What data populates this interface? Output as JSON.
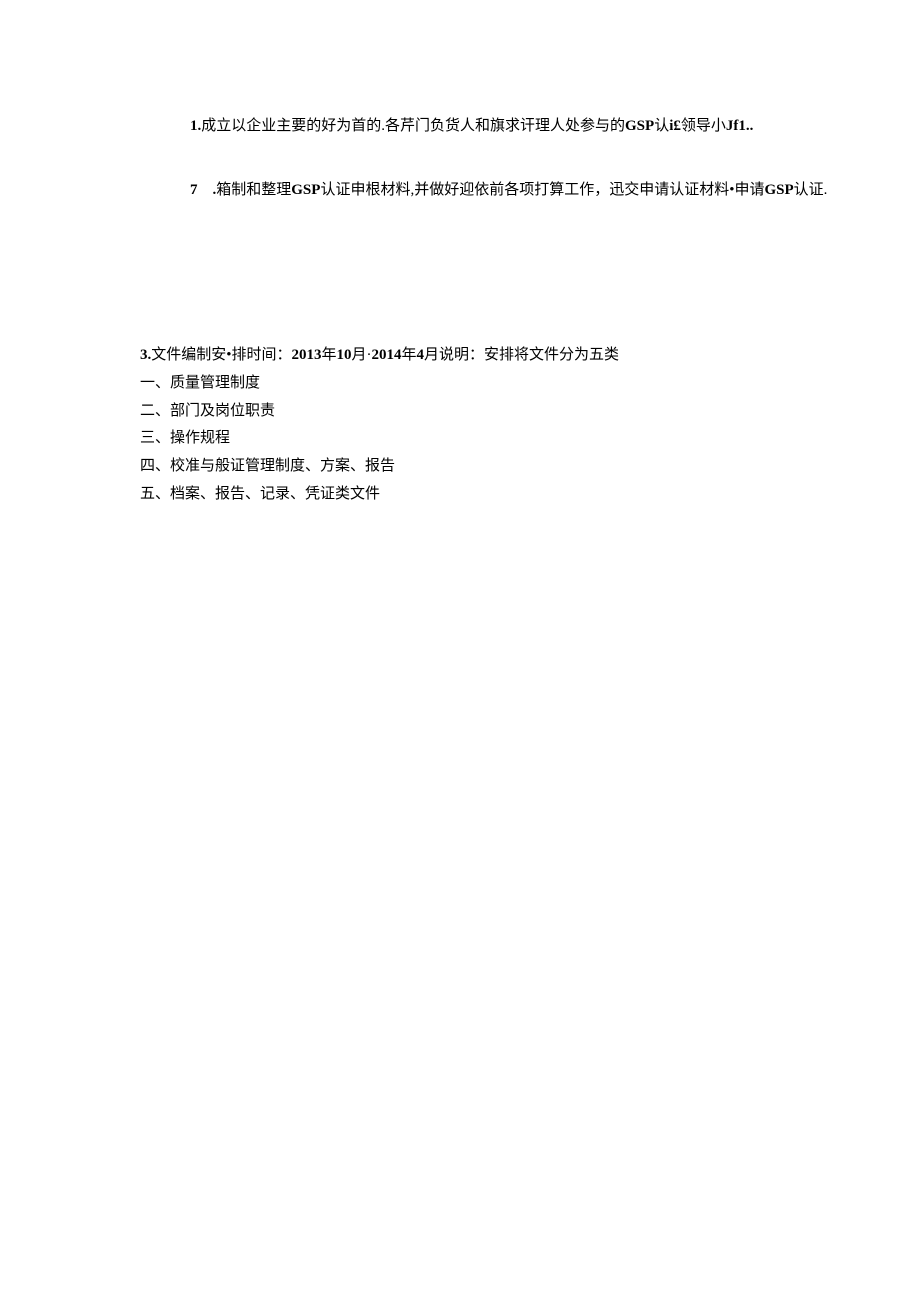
{
  "item1": {
    "prefix": "1.",
    "text": "成立以企业主要的好为首的.各芹门负货人和旗求讦理人处参与的",
    "bold1": "GSP",
    "text2": "认",
    "bold2": "i£",
    "text3": "领导小",
    "bold3": "Jf1.."
  },
  "item7": {
    "prefix": "7",
    "dot": ".",
    "text1": "箱制和整理",
    "bold1": "GSP",
    "text2": "认证申根材料,并做好迎依前各项打算工作，迅交申请认证材料•申请",
    "bold2": "GSP",
    "text3": "认证."
  },
  "section3": {
    "line1_prefix": "3.",
    "line1_text1": "文件编制安•排时间：",
    "line1_bold1": "2013",
    "line1_text2": "年",
    "line1_bold2": "10",
    "line1_text3": "月·",
    "line1_bold3": "2014",
    "line1_text4": "年",
    "line1_bold4": "4",
    "line1_text5": "月说明：安排将文件分为五类",
    "line2": "一、质量管理制度",
    "line3": "二、部门及岗位职责",
    "line4": "三、操作规程",
    "line5": "四、校准与般证管理制度、方案、报告",
    "line6": "五、档案、报告、记录、凭证类文件"
  }
}
